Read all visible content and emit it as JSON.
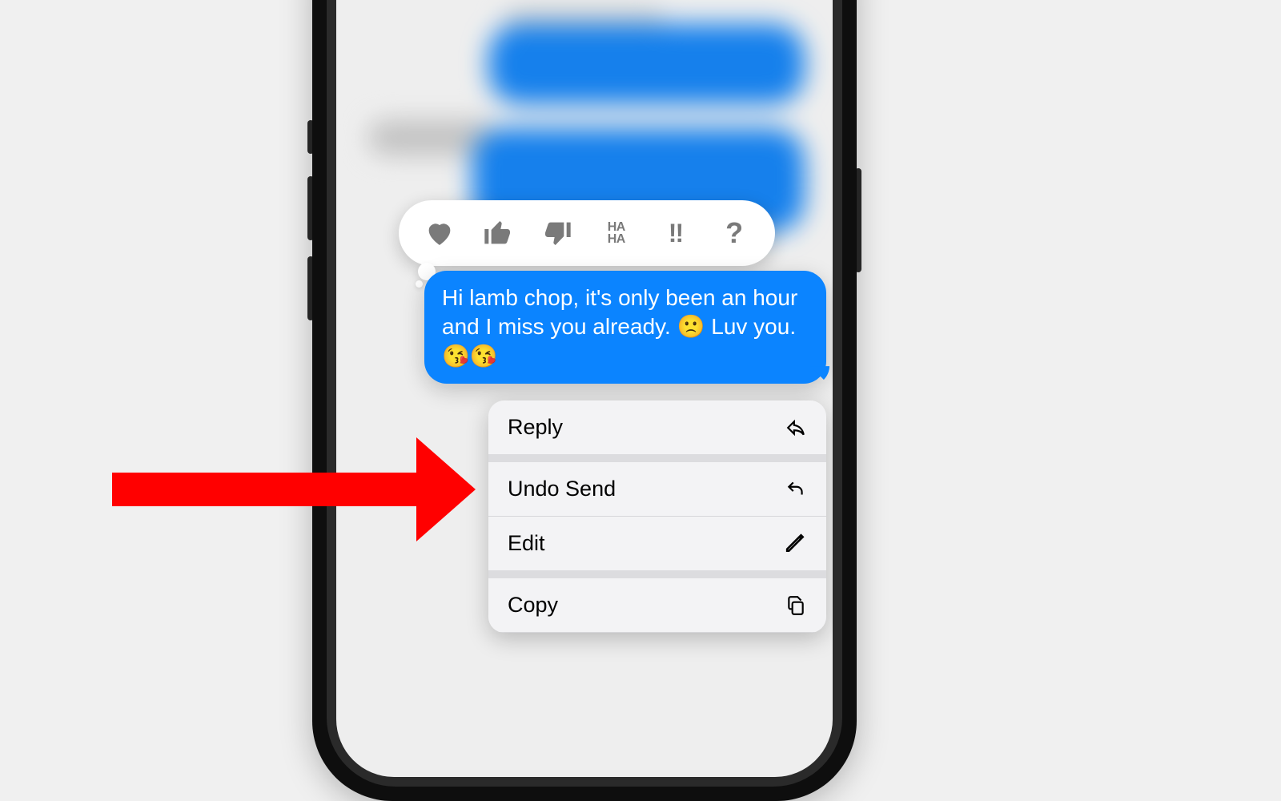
{
  "colors": {
    "bubble_blue": "#0b84ff",
    "arrow_red": "#ff0000",
    "tapback_grey": "#7a7a7a"
  },
  "tapbacks": [
    {
      "name": "heart",
      "label": "♥"
    },
    {
      "name": "thumbs-up",
      "label": "👍"
    },
    {
      "name": "thumbs-down",
      "label": "👎"
    },
    {
      "name": "haha",
      "label": "HA HA"
    },
    {
      "name": "exclaim",
      "label": "!!"
    },
    {
      "name": "question",
      "label": "?"
    }
  ],
  "message": {
    "text": "Hi lamb chop, it's only been an hour and I miss you already. 🙁 Luv you. 😘😘"
  },
  "context_menu": {
    "items": [
      {
        "label": "Reply",
        "icon": "reply"
      },
      {
        "label": "Undo Send",
        "icon": "undo"
      },
      {
        "label": "Edit",
        "icon": "pencil"
      },
      {
        "label": "Copy",
        "icon": "copy"
      }
    ]
  },
  "annotation": {
    "arrow_target": "Undo Send"
  }
}
